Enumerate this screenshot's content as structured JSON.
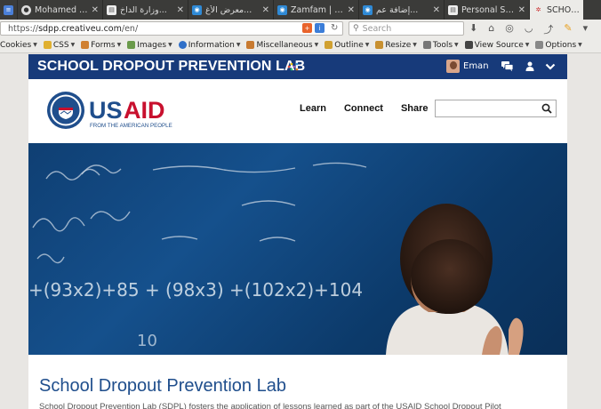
{
  "browser": {
    "tabs": [
      {
        "title": "",
        "favicon": "docs-icon",
        "active": false
      },
      {
        "title": "Mohamed Elsa...",
        "favicon": "profile-icon",
        "active": false
      },
      {
        "title": "وزارة الداخ...",
        "favicon": "page-icon",
        "active": false
      },
      {
        "title": "معرض الأغ...",
        "favicon": "zamfam-icon",
        "active": false
      },
      {
        "title": "Zamfam | م...",
        "favicon": "zamfam-icon",
        "active": false
      },
      {
        "title": "إضافة عم...",
        "favicon": "zamfam-icon",
        "active": false
      },
      {
        "title": "Personal Sit...",
        "favicon": "page-icon",
        "active": false
      },
      {
        "title": "SCHOOL",
        "favicon": "sdpl-icon",
        "active": true
      }
    ],
    "url_scheme": "https://",
    "url_host": "sdpp.creativeu.com",
    "url_path": "/en/",
    "search_placeholder": "Search"
  },
  "devtoolbar": {
    "items": [
      "Cookies",
      "CSS",
      "Forms",
      "Images",
      "Information",
      "Miscellaneous",
      "Outline",
      "Resize",
      "Tools",
      "View Source",
      "Options"
    ]
  },
  "site": {
    "title": "SCHOOL DROPOUT PREVENTION LAB",
    "user_name": "Eman",
    "logo_text": "USAID",
    "logo_tagline": "FROM THE AMERICAN PEOPLE",
    "nav": [
      "Learn",
      "Connect",
      "Share"
    ],
    "search_value": "",
    "hero_chalk": [
      "+(93x2)+85 + (98x3) +(102x2)+104",
      "10"
    ],
    "intro_title": "School Dropout Prevention Lab",
    "intro_text": "School Dropout Prevention Lab (SDPL) fosters the application of lessons learned as part of the USAID School Dropout Pilot"
  },
  "colors": {
    "site_bar": "#173a7a",
    "usaid_blue": "#1f4e8c",
    "usaid_red": "#c8102e"
  }
}
